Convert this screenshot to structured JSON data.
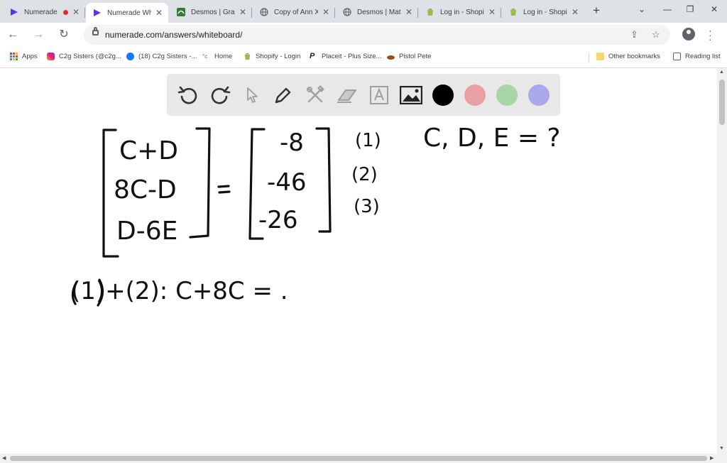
{
  "browser": {
    "tabs": [
      {
        "title": "Numerade",
        "icon": "numerade-icon",
        "recording": true,
        "active": false
      },
      {
        "title": "Numerade Whiteboard",
        "icon": "numerade-icon",
        "active": true
      },
      {
        "title": "Desmos | Graphing Calculator",
        "icon": "desmos-icon",
        "active": false
      },
      {
        "title": "Copy of Ann X",
        "icon": "globe-icon",
        "active": false
      },
      {
        "title": "Desmos | Matrix Calculator",
        "icon": "globe-icon",
        "active": false
      },
      {
        "title": "Log in - Shopify",
        "icon": "shopify-icon",
        "active": false
      },
      {
        "title": "Log in - Shopify",
        "icon": "shopify-icon",
        "active": false
      }
    ],
    "new_tab_label": "+",
    "url": "numerade.com/answers/whiteboard/",
    "colors": {
      "tab_strip": "#dee1e6",
      "numerade_purple": "#5f33e1",
      "desmos_green": "#2f7d31",
      "shopify_green": "#95bf47"
    }
  },
  "bookmarks": {
    "items": [
      {
        "label": "Apps",
        "icon": "apps-grid-icon"
      },
      {
        "label": "C2g Sisters (@c2g...",
        "icon": "instagram-icon"
      },
      {
        "label": "(18) C2g Sisters -...",
        "icon": "facebook-icon"
      },
      {
        "label": "Home",
        "icon": "home-site-icon"
      },
      {
        "label": "Shopify - Login",
        "icon": "shopify-icon"
      },
      {
        "label": "Placeit - Plus Size...",
        "icon": "placeit-icon"
      },
      {
        "label": "Pistol Pete",
        "icon": "pistol-pete-icon"
      }
    ],
    "other": "Other bookmarks",
    "reading_list": "Reading list"
  },
  "whiteboard": {
    "tools": [
      "undo-icon",
      "redo-icon",
      "select-cursor-icon",
      "pen-icon",
      "tools-icon",
      "eraser-icon",
      "text-icon",
      "image-icon"
    ],
    "colors": [
      "#000000",
      "#e8a0a5",
      "#a9d6a9",
      "#aaa8ea"
    ],
    "handwriting": {
      "left_matrix": [
        "C+D",
        "8C-D",
        "D-6E"
      ],
      "equals": "=",
      "right_matrix": [
        "-8",
        "-46",
        "-26"
      ],
      "labels": [
        "(1)",
        "(2)",
        "(3)"
      ],
      "question": "C, D, E = ?",
      "step": "(1)+(2): C+8C = ."
    }
  }
}
